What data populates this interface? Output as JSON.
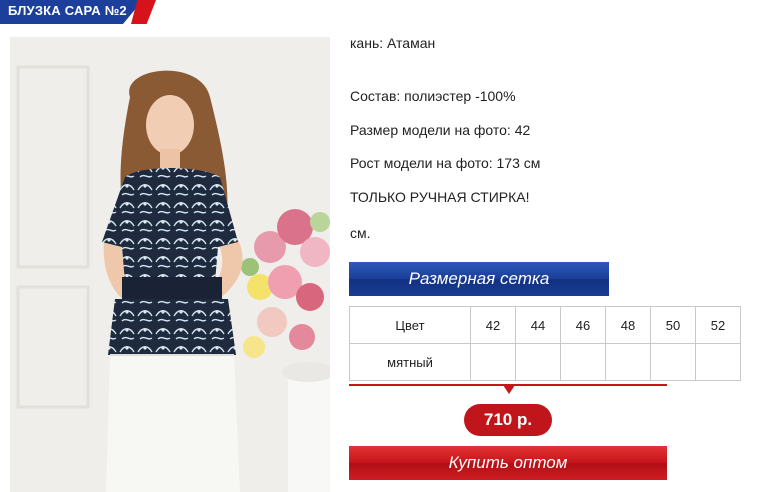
{
  "product": {
    "title": "БЛУЗКА САРА №2"
  },
  "description": {
    "fabric": " кань: Атаман",
    "composition": "Состав: полиэстер -100%",
    "model_size": "Размер модели на фото: 42",
    "model_height": "Рост модели на фото: 173 см",
    "care": "ТОЛЬКО РУЧНАЯ СТИРКА!",
    "extra": "см."
  },
  "buttons": {
    "size_chart": "Размерная сетка",
    "buy_wholesale": "Купить оптом"
  },
  "size_table": {
    "header_label": "Цвет",
    "sizes": [
      "42",
      "44",
      "46",
      "48",
      "50",
      "52"
    ],
    "rows": [
      {
        "color": "мятный",
        "cells": [
          "",
          "",
          "",
          "",
          "",
          ""
        ]
      }
    ]
  },
  "price": "710 р.",
  "colors": {
    "brand_blue": "#1b3f9a",
    "brand_red": "#c8141b"
  }
}
